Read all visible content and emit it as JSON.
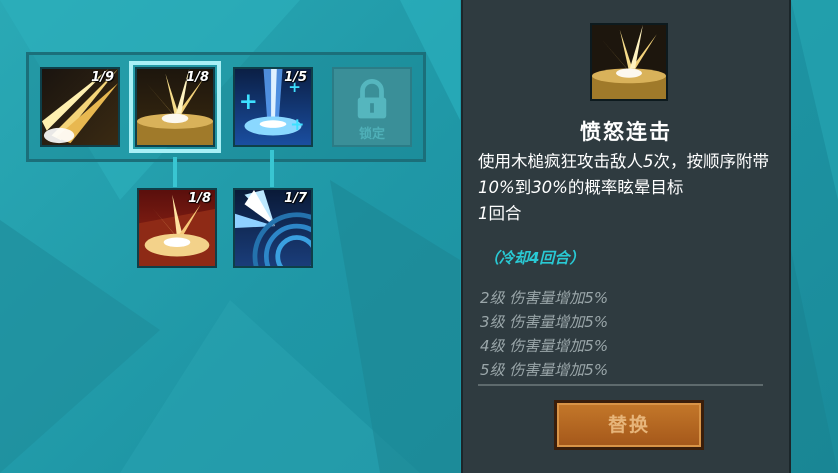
{
  "skill_tree": {
    "row1": [
      {
        "name": "slash-skill",
        "level": "1/9"
      },
      {
        "name": "rage-combo-skill",
        "level": "1/8",
        "selected": true
      },
      {
        "name": "blue-burst-skill",
        "level": "1/5"
      },
      {
        "name": "locked-skill",
        "label": "锁定"
      }
    ],
    "row2": [
      {
        "name": "red-burst-skill",
        "level": "1/8"
      },
      {
        "name": "shockwave-skill",
        "level": "1/7"
      }
    ]
  },
  "detail": {
    "title": "愤怒连击",
    "desc_part1": "使用木槌疯狂攻击敌人",
    "desc_num1": "5",
    "desc_part2": "次，按顺序附带",
    "desc_num2": "10%",
    "desc_part3": "到",
    "desc_num3": "30%",
    "desc_part4": "的概率眩晕目标",
    "desc_num4": "1",
    "desc_part5": "回合",
    "cooldown": "（冷却4回合）",
    "upgrades": [
      "2级 伤害量增加5%",
      "3级 伤害量增加5%",
      "4级 伤害量增加5%",
      "5级 伤害量增加5%"
    ],
    "replace_label": "替换"
  },
  "colors": {
    "accent": "#29c9d4",
    "panel_bg": "#2f3b40",
    "button": "#b46424"
  },
  "icons": {
    "locked": "lock-icon"
  }
}
